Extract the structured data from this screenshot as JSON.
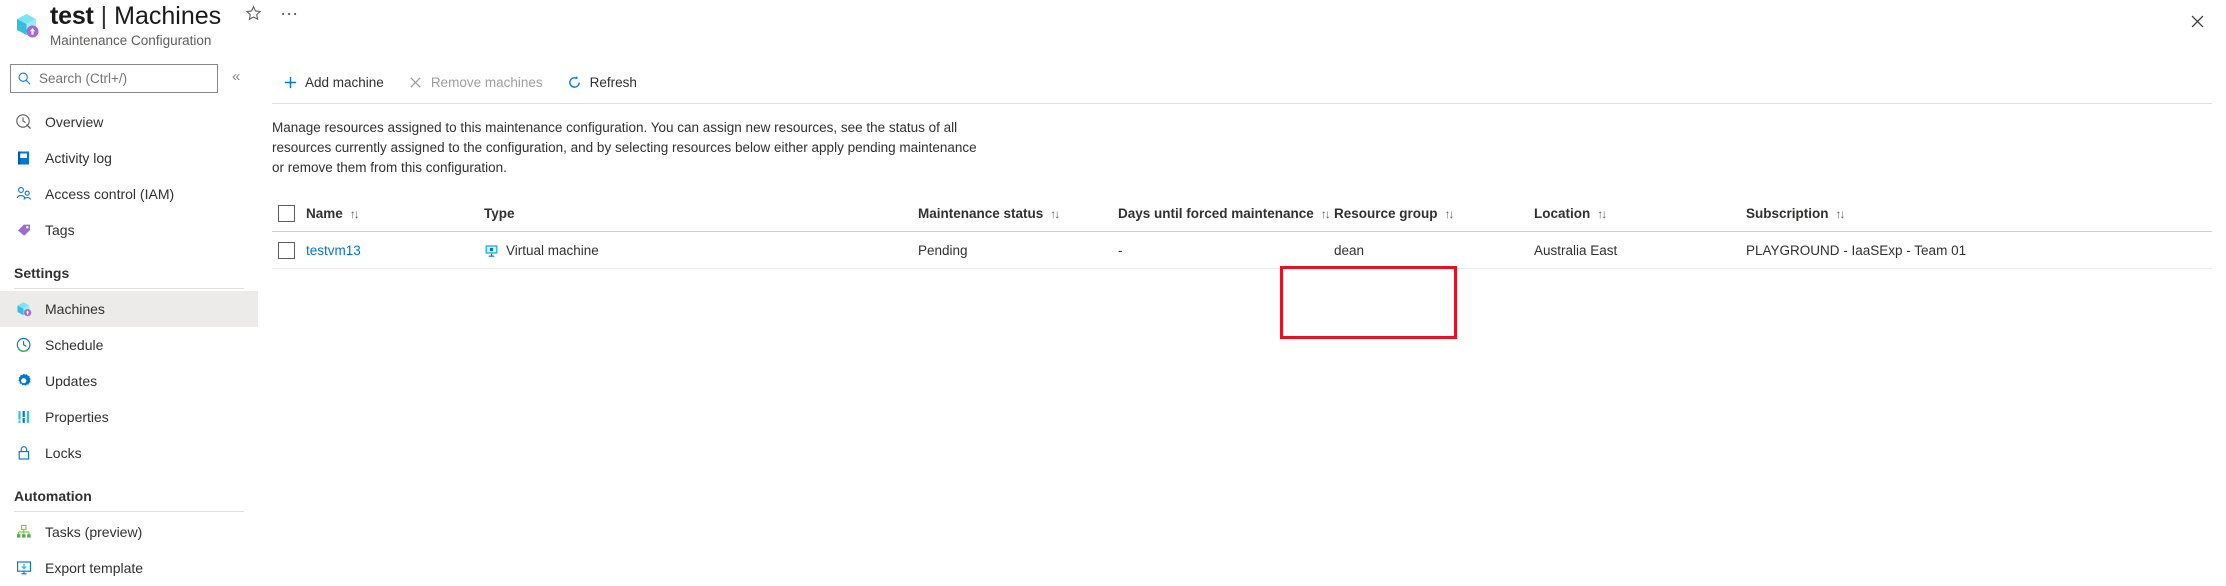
{
  "header": {
    "resource_icon": "maintenance-configuration-icon",
    "title": "test",
    "separator": "|",
    "page": "Machines",
    "favorite_icon": "star-icon",
    "more_icon": "ellipsis-icon",
    "subtitle": "Maintenance Configuration",
    "close_icon": "close-icon"
  },
  "sidebar": {
    "search": {
      "placeholder": "Search (Ctrl+/)",
      "value": "",
      "icon": "search-icon"
    },
    "collapse_icon": "chevron-double-left-icon",
    "items": [
      {
        "label": "Overview",
        "icon": "overview-icon",
        "selected": false
      },
      {
        "label": "Activity log",
        "icon": "activity-log-icon",
        "selected": false
      },
      {
        "label": "Access control (IAM)",
        "icon": "access-control-icon",
        "selected": false
      },
      {
        "label": "Tags",
        "icon": "tags-icon",
        "selected": false
      }
    ],
    "groups": [
      {
        "label": "Settings",
        "items": [
          {
            "label": "Machines",
            "icon": "machines-icon",
            "selected": true
          },
          {
            "label": "Schedule",
            "icon": "schedule-icon",
            "selected": false
          },
          {
            "label": "Updates",
            "icon": "updates-icon",
            "selected": false
          },
          {
            "label": "Properties",
            "icon": "properties-icon",
            "selected": false
          },
          {
            "label": "Locks",
            "icon": "locks-icon",
            "selected": false
          }
        ]
      },
      {
        "label": "Automation",
        "items": [
          {
            "label": "Tasks (preview)",
            "icon": "tasks-icon",
            "selected": false
          },
          {
            "label": "Export template",
            "icon": "export-template-icon",
            "selected": false
          }
        ]
      }
    ]
  },
  "toolbar": {
    "add_machine": {
      "label": "Add machine",
      "icon": "plus-icon",
      "disabled": false
    },
    "remove_machines": {
      "label": "Remove machines",
      "icon": "x-icon",
      "disabled": true
    },
    "refresh": {
      "label": "Refresh",
      "icon": "refresh-icon",
      "disabled": false
    }
  },
  "description": "Manage resources assigned to this maintenance configuration. You can assign new resources, see the status of all resources currently assigned to the configuration, and by selecting resources below either apply pending maintenance or remove them from this configuration.",
  "table": {
    "columns": [
      {
        "label": "Name",
        "sortable": true
      },
      {
        "label": "Type",
        "sortable": false
      },
      {
        "label": "Maintenance status",
        "sortable": true
      },
      {
        "label": "Days until forced maintenance",
        "sortable": true
      },
      {
        "label": "Resource group",
        "sortable": true
      },
      {
        "label": "Location",
        "sortable": true
      },
      {
        "label": "Subscription",
        "sortable": true
      }
    ],
    "sort_glyph": "↑↓",
    "rows": [
      {
        "selected": false,
        "name": "testvm13",
        "type": "Virtual machine",
        "type_icon": "virtual-machine-icon",
        "maintenance_status": "Pending",
        "days_until_forced_maintenance": "-",
        "resource_group": "dean",
        "location": "Australia East",
        "subscription": "PLAYGROUND - IaaSExp - Team 01"
      }
    ]
  },
  "annotation": {
    "highlight_color": "#e81123",
    "target": "maintenance-status-column"
  }
}
